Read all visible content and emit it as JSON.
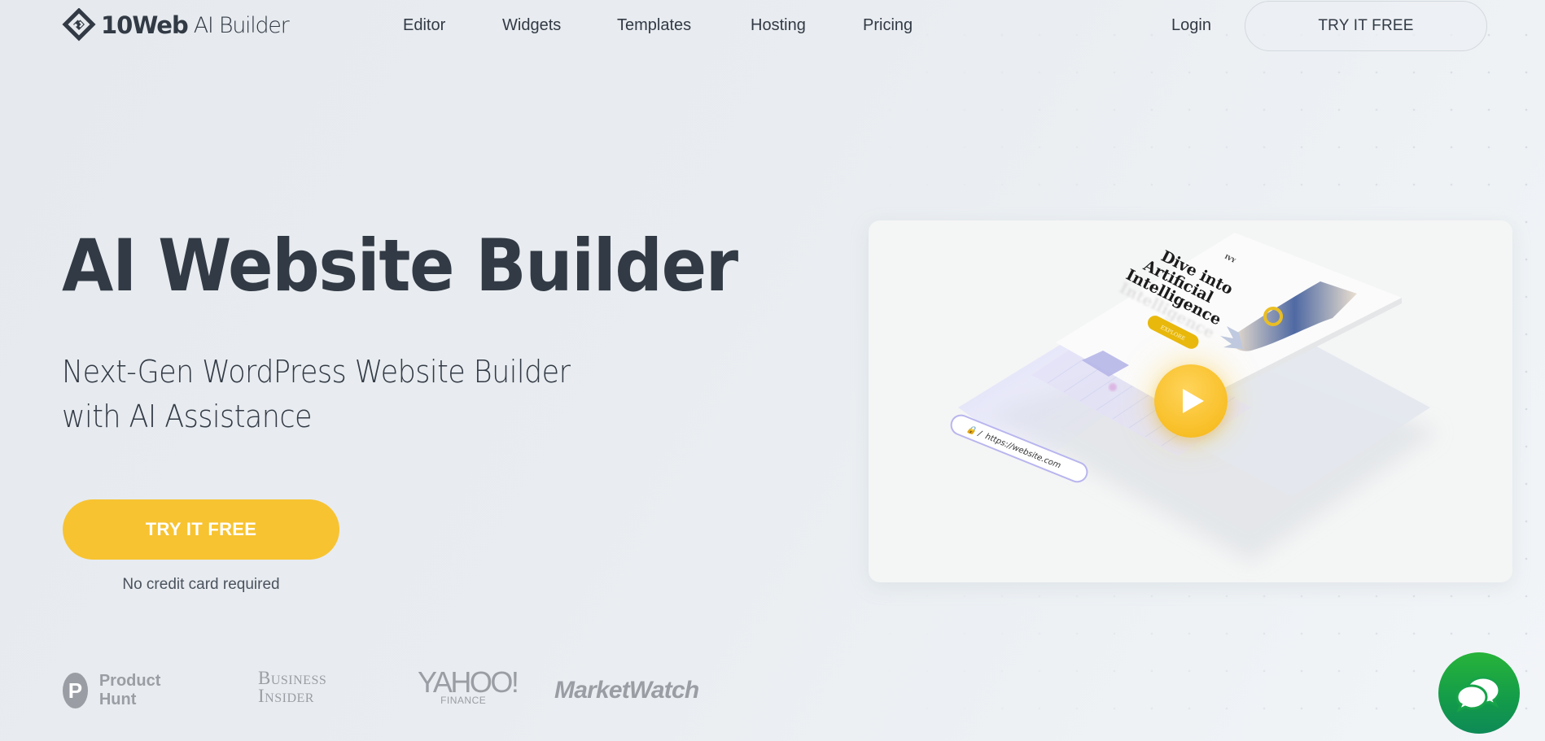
{
  "header": {
    "logo": {
      "brand": "10Web",
      "product": "AI Builder",
      "icon": "10web-diamond-logo-icon"
    },
    "nav": [
      {
        "label": "Editor"
      },
      {
        "label": "Widgets"
      },
      {
        "label": "Templates"
      },
      {
        "label": "Hosting"
      },
      {
        "label": "Pricing"
      }
    ],
    "login_label": "Login",
    "cta_label": "TRY IT FREE"
  },
  "hero": {
    "title": "AI Website Builder",
    "subtitle_line1": "Next-Gen WordPress Website Builder",
    "subtitle_line2": "with AI Assistance",
    "cta_label": "TRY IT FREE",
    "cta_note": "No credit card required",
    "accent_color": "#f7c331"
  },
  "press": {
    "product_hunt": {
      "letter": "P",
      "label": "Product Hunt"
    },
    "business_insider": {
      "line1": "Business",
      "line2": "Insider"
    },
    "yahoo_finance": {
      "main": "YAHOO!",
      "sub": "FINANCE"
    },
    "marketwatch": {
      "label": "MarketWatch"
    }
  },
  "video": {
    "mock_headline_1": "Dive into",
    "mock_headline_2": "Artificial",
    "mock_headline_3": "Intelligence",
    "mock_button": "EXPLORE",
    "mock_brand": "IVY",
    "mock_url": "https://website.com",
    "play_icon": "play-icon"
  },
  "chat": {
    "icon": "chat-bubbles-icon",
    "color": "#1fa945"
  }
}
